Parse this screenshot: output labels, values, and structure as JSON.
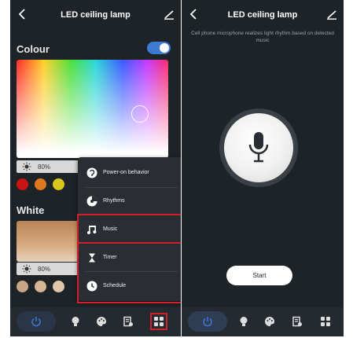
{
  "left": {
    "title": "LED ceiling lamp",
    "colour_label": "Colour",
    "colour_brightness": "80%",
    "white_label": "White",
    "white_brightness": "80%",
    "menu": [
      {
        "label": "Power-on behavior",
        "icon": "power-on-icon"
      },
      {
        "label": "Rhythms",
        "icon": "rhythms-icon"
      },
      {
        "label": "Music",
        "icon": "music-icon"
      },
      {
        "label": "Timer",
        "icon": "hourglass-icon"
      },
      {
        "label": "Schedule",
        "icon": "clock-icon"
      }
    ],
    "color_swatches": [
      "#c81414",
      "#e07820",
      "#d8c81e"
    ],
    "white_swatches": [
      "#c8a584",
      "#d6b596",
      "#e0c7ac"
    ]
  },
  "right": {
    "title": "LED ceiling lamp",
    "hint": "Cell phone microphone realizes light rhythm based on detected music",
    "start_label": "Start"
  },
  "nav_icons": [
    "power-icon",
    "bulb-icon",
    "palette-icon",
    "scene-icon",
    "more-grid-icon"
  ],
  "colors": {
    "background": "#1e2328",
    "accent": "#3d7bd3",
    "highlight": "#d0202a",
    "navbar": "#252a30"
  }
}
